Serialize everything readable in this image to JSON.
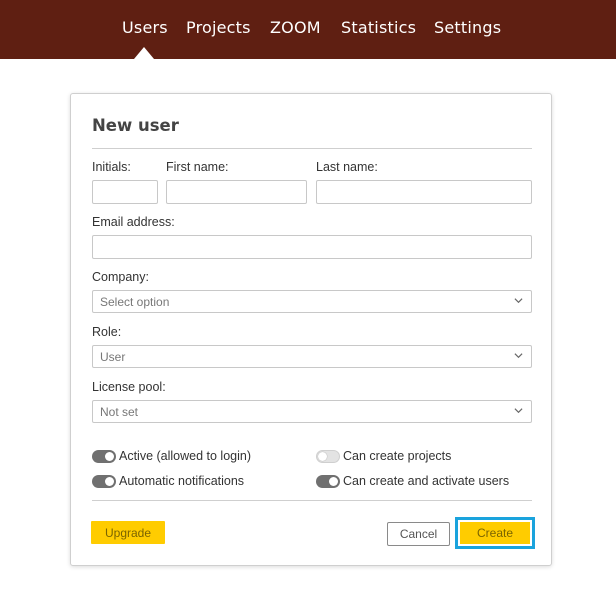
{
  "nav": {
    "items": [
      {
        "label": "Users",
        "active": true
      },
      {
        "label": "Projects"
      },
      {
        "label": "ZOOM"
      },
      {
        "label": "Statistics"
      },
      {
        "label": "Settings"
      }
    ],
    "background": "#5f1f12"
  },
  "form": {
    "title": "New user",
    "initials_label": "Initials:",
    "first_name_label": "First name:",
    "last_name_label": "Last name:",
    "initials_value": "",
    "first_name_value": "",
    "last_name_value": "",
    "email_label": "Email address:",
    "email_value": "",
    "company_label": "Company:",
    "company_value": "Select option",
    "role_label": "Role:",
    "role_value": "User",
    "license_label": "License pool:",
    "license_value": "Not set",
    "toggles": [
      {
        "label": "Active (allowed to login)",
        "on": true
      },
      {
        "label": "Can create projects",
        "on": false
      },
      {
        "label": "Automatic notifications",
        "on": true
      },
      {
        "label": "Can create and activate users",
        "on": true
      }
    ],
    "upgrade_label": "Upgrade",
    "cancel_label": "Cancel",
    "create_label": "Create"
  },
  "colors": {
    "accent_yellow": "#ffcc00",
    "focus_blue": "#1aa3dd"
  },
  "icons": {
    "select_chevron": "chevron-down-icon"
  }
}
